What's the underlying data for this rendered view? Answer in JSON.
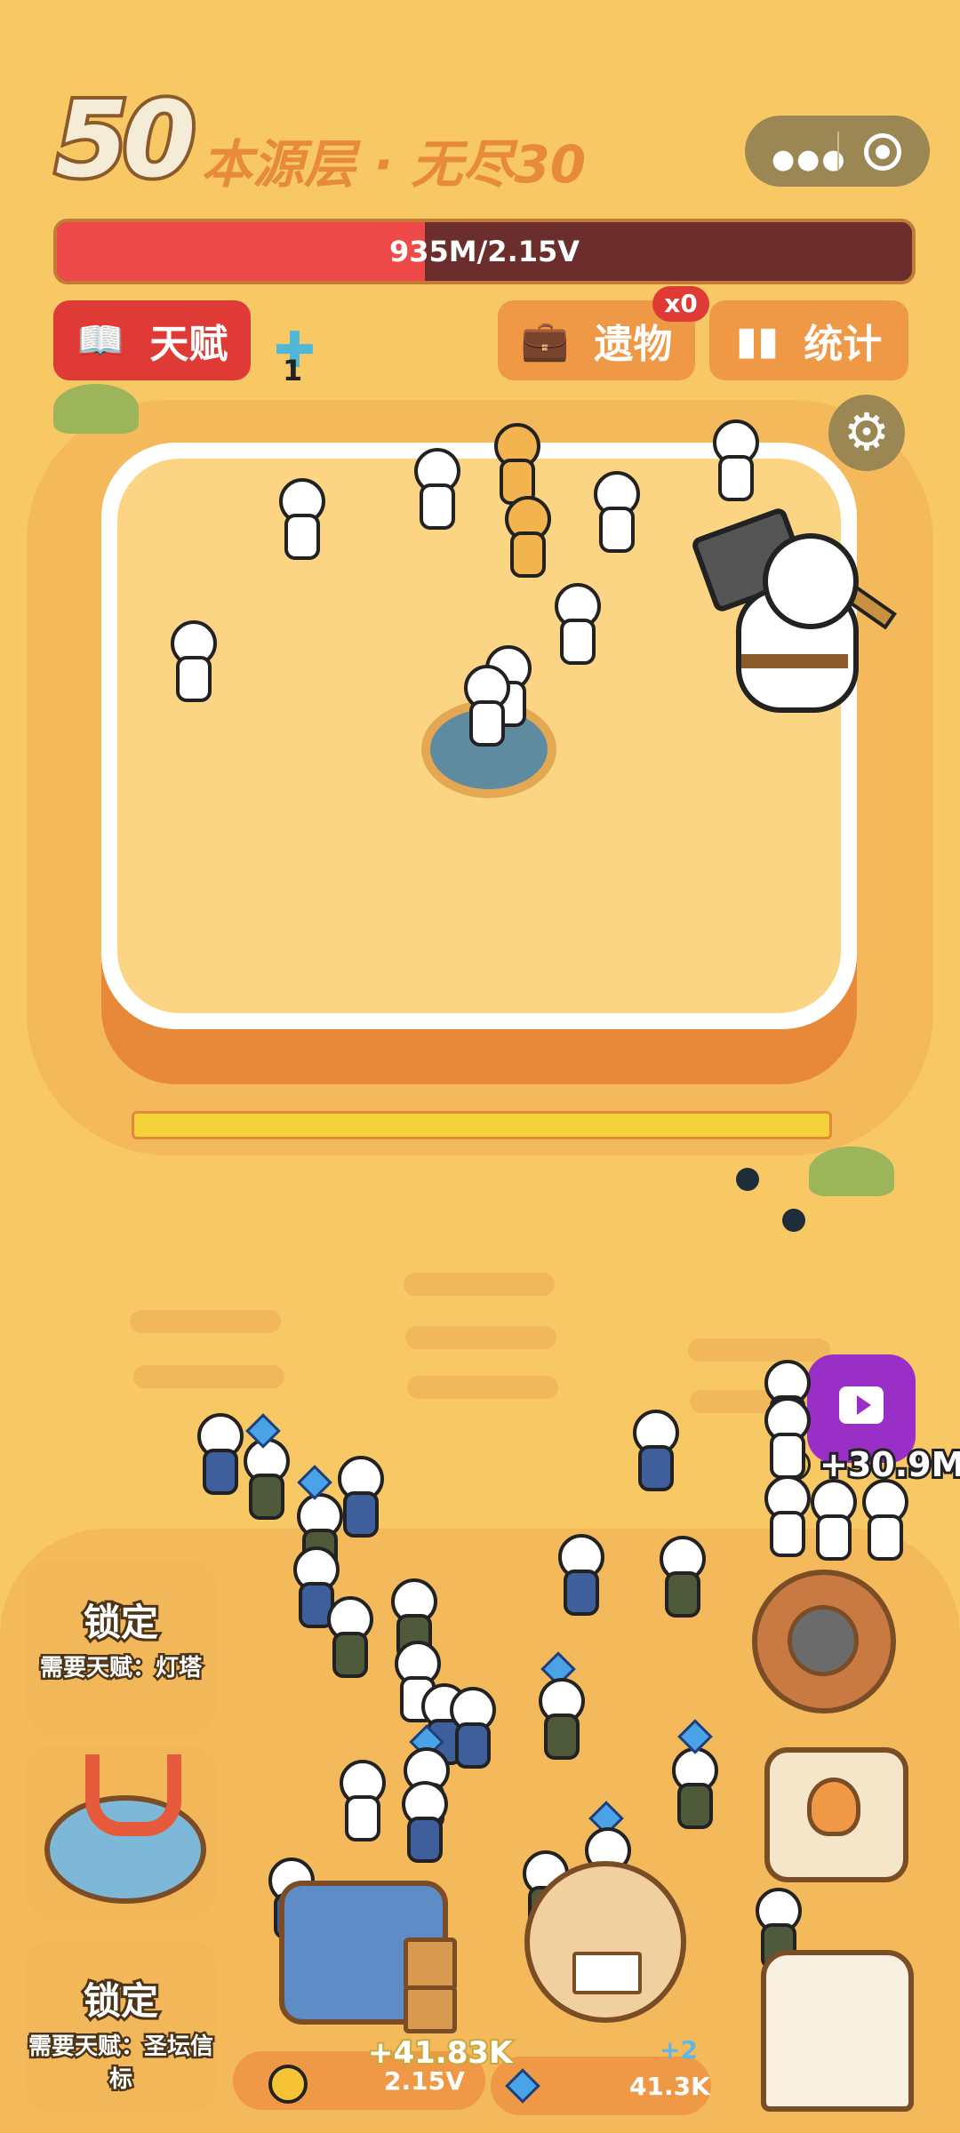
{
  "header": {
    "level": "50",
    "title": "本源层 · 无尽30",
    "hp_text": "935M/2.15V",
    "hp_fraction": 0.43
  },
  "menu_capsule": {
    "more_icon": "more-dots-icon",
    "close_icon": "target-close-icon"
  },
  "buttons": {
    "talent": "天赋",
    "relic": "遗物",
    "relic_badge": "x0",
    "stats": "统计",
    "cross_count": "1"
  },
  "icons": {
    "talent": "book-icon",
    "relic": "briefcase-icon",
    "stats": "bar-chart-icon",
    "settings": "gear-icon",
    "cross": "cross-icon"
  },
  "progress_fraction": 1.0,
  "locked_slots": [
    {
      "title": "锁定",
      "requirement": "需要天赋：灯塔"
    },
    {
      "title": "锁定",
      "requirement": "需要天赋：圣坛信标"
    }
  ],
  "ad_bonus": "+30.9M",
  "resources": {
    "gold": "2.15V",
    "gem": "41.3K",
    "gem_plus": "+2",
    "floating_gain": "+41.83K"
  },
  "colors": {
    "sand": "#f8c865",
    "accent_red": "#e03a36",
    "accent_orange": "#ef9946",
    "hp_bar": "#ee4a49",
    "ad_purple": "#9a2fc8"
  }
}
